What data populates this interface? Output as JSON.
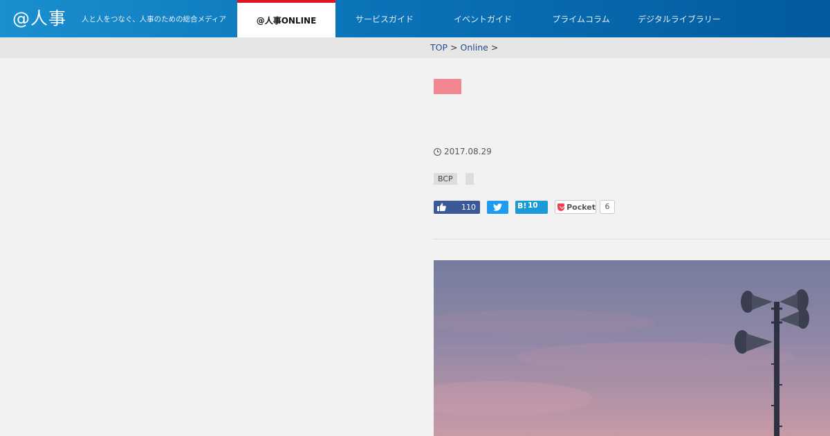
{
  "header": {
    "logo": "@人事",
    "tagline": "人と人をつなぐ、人事のための総合メディア",
    "nav": [
      {
        "label": "@人事ONLINE",
        "active": true
      },
      {
        "label": "サービスガイド"
      },
      {
        "label": "イベントガイド"
      },
      {
        "label": "プライムコラム"
      },
      {
        "label": "デジタルライブラリー"
      }
    ]
  },
  "breadcrumb": {
    "items": [
      "TOP",
      "Online"
    ],
    "separator": ">"
  },
  "article": {
    "category_color": "#f28791",
    "date": "2017.08.29",
    "tags": [
      "BCP",
      ""
    ],
    "social": {
      "facebook_count": "110",
      "hatena_label": "B!",
      "hatena_count": "10",
      "pocket_label": "Pocket",
      "pocket_count": "6"
    }
  },
  "colors": {
    "header_start": "#1b8fd0",
    "header_end": "#035a9d",
    "active_nav_accent": "#e0141e",
    "link": "#1e4b8f"
  }
}
